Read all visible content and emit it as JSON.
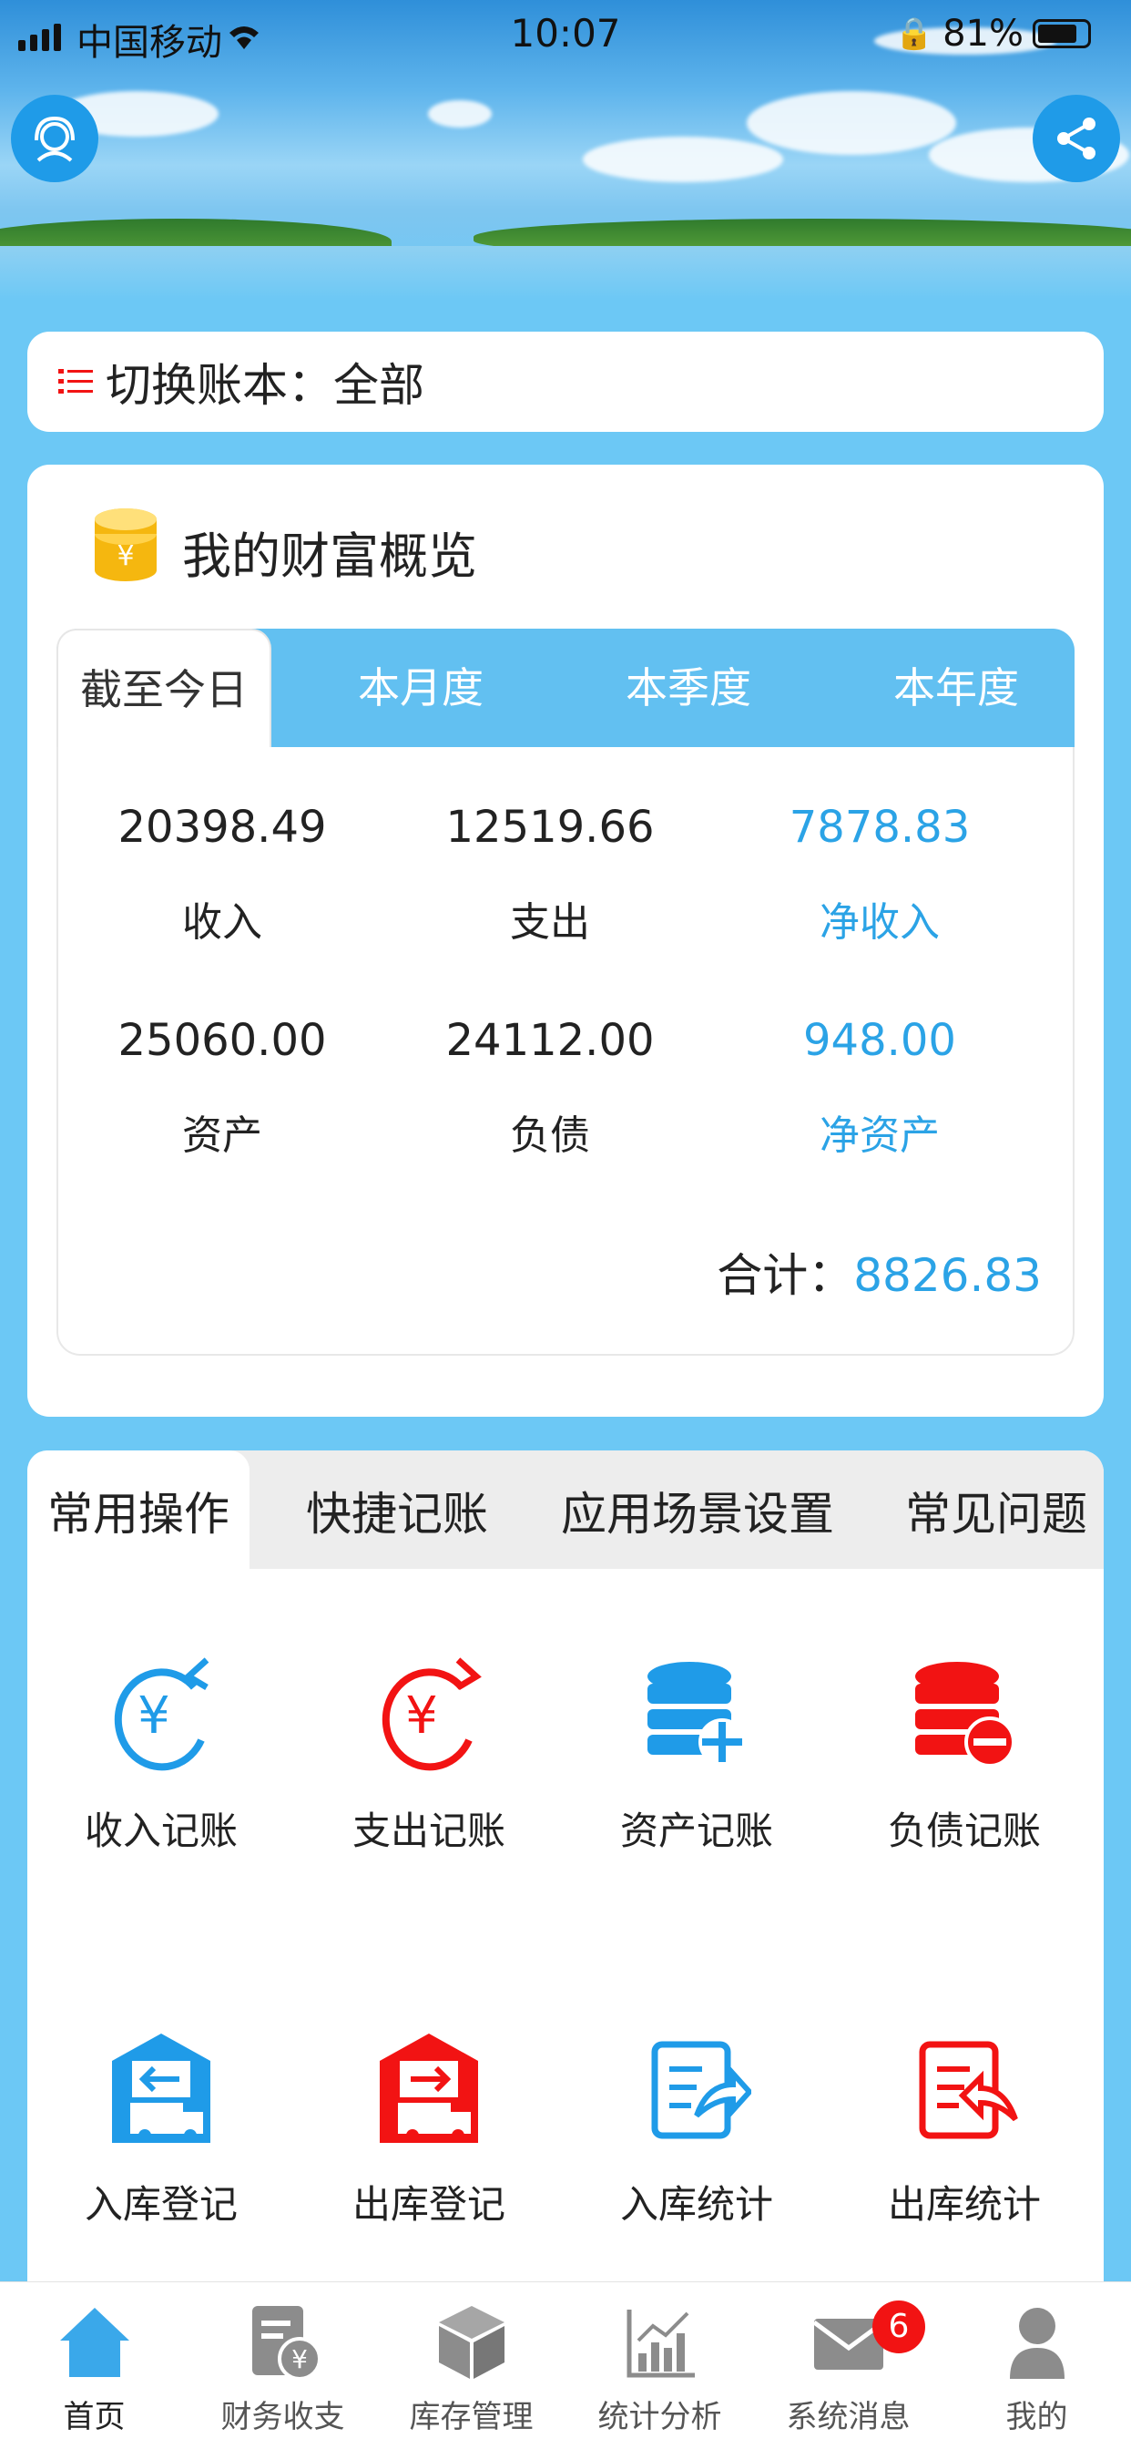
{
  "status": {
    "carrier": "中国移动",
    "time": "10:07",
    "battery": "81%"
  },
  "switch_ledger": {
    "label": "切换账本：",
    "value": "全部"
  },
  "overview": {
    "title": "我的财富概览",
    "tabs": [
      "截至今日",
      "本月度",
      "本季度",
      "本年度"
    ],
    "active_tab": "截至今日",
    "rows": [
      [
        {
          "value": "20398.49",
          "label": "收入"
        },
        {
          "value": "12519.66",
          "label": "支出"
        },
        {
          "value": "7878.83",
          "label": "净收入"
        }
      ],
      [
        {
          "value": "25060.00",
          "label": "资产"
        },
        {
          "value": "24112.00",
          "label": "负债"
        },
        {
          "value": "948.00",
          "label": "净资产"
        }
      ]
    ],
    "total_label": "合计：",
    "total_value": "8826.83"
  },
  "ops": {
    "tabs": [
      "常用操作",
      "快捷记账",
      "应用场景设置",
      "常见问题"
    ],
    "active_tab": "常用操作",
    "items": [
      "收入记账",
      "支出记账",
      "资产记账",
      "负债记账",
      "入库登记",
      "出库登记",
      "入库统计",
      "出库统计"
    ]
  },
  "nav": {
    "items": [
      "首页",
      "财务收支",
      "库存管理",
      "统计分析",
      "系统消息",
      "我的"
    ],
    "badge": "6"
  },
  "colors": {
    "accent": "#2ba3e6",
    "tabbar": "#62c0f1",
    "red": "#f21313",
    "background": "#6cc8f5"
  }
}
